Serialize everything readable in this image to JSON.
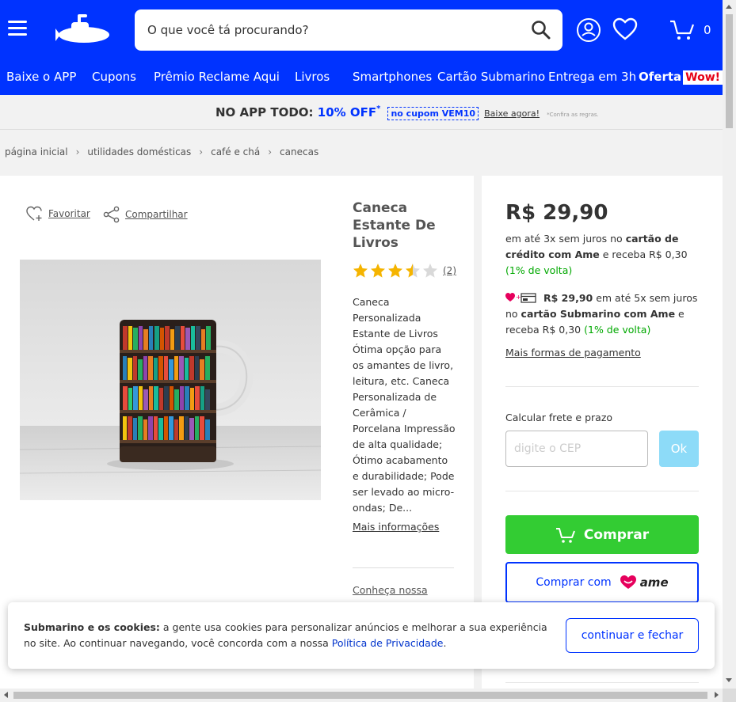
{
  "header": {
    "search_placeholder": "O que você tá procurando?",
    "cart_count": "0",
    "brand_color": "#0033ff"
  },
  "nav": {
    "items": [
      "Baixe o APP",
      "Cupons",
      "Prêmio Reclame Aqui",
      "Livros",
      "Smartphones",
      "Cartão Submarino",
      "Entrega em 3h"
    ],
    "offer_label": "Oferta",
    "offer_badge": "Wow!"
  },
  "promo": {
    "prefix": "NO APP TODO: ",
    "highlight": "10% OFF",
    "star": "*",
    "coupon": "no cupom VEM10",
    "cta": "Baixe agora!",
    "fine_print": "*Confira as regras."
  },
  "breadcrumb": [
    "página inicial",
    "utilidades domésticas",
    "café e chá",
    "canecas"
  ],
  "product": {
    "favorite_label": "Favoritar",
    "share_label": "Compartilhar",
    "title": "Caneca Estante De Livros",
    "rating": 3.5,
    "rating_max": 5,
    "review_count": "(2)",
    "description": "Caneca Personalizada Estante de Livros Ótima opção para os amantes de livro, leitura, etc. Caneca Personalizada de Cerâmica / Porcelana Impressão de alta qualidade; Ótimo acabamento e durabilidade; Pode ser levado ao micro-ondas; De...",
    "more_info": "Mais informações",
    "know_our": "Conheça nossa"
  },
  "buybox": {
    "price": "R$ 29,90",
    "inst_1": "em até 3x sem juros no ",
    "inst_card": "cartão de crédito com Ame",
    "inst_2": " e receba R$ 0,30 ",
    "inst_cashback": "(1% de volta)",
    "ame_price": "R$ 29,90",
    "ame_1": " em até 5x sem juros no ",
    "ame_card": "cartão Submarino com Ame",
    "ame_2": " e receba R$ 0,30 ",
    "ame_cashback": "(1% de volta)",
    "more_payment": "Mais formas de pagamento",
    "shipping_label": "Calcular frete e prazo",
    "cep_placeholder": "digite o CEP",
    "ok_label": "Ok",
    "buy_label": "Comprar",
    "buy_ame_label": "Comprar com",
    "ame_brand": "ame",
    "buy_color": "#33cc33"
  },
  "cookie": {
    "bold": "Submarino e os cookies:",
    "text_1": " a gente usa cookies para personalizar anúncios e melhorar a sua experiência no site. Ao continuar navegando, você concorda com a nossa ",
    "link": "Política de Privacidade",
    "text_2": ".",
    "button": "continuar e fechar"
  }
}
